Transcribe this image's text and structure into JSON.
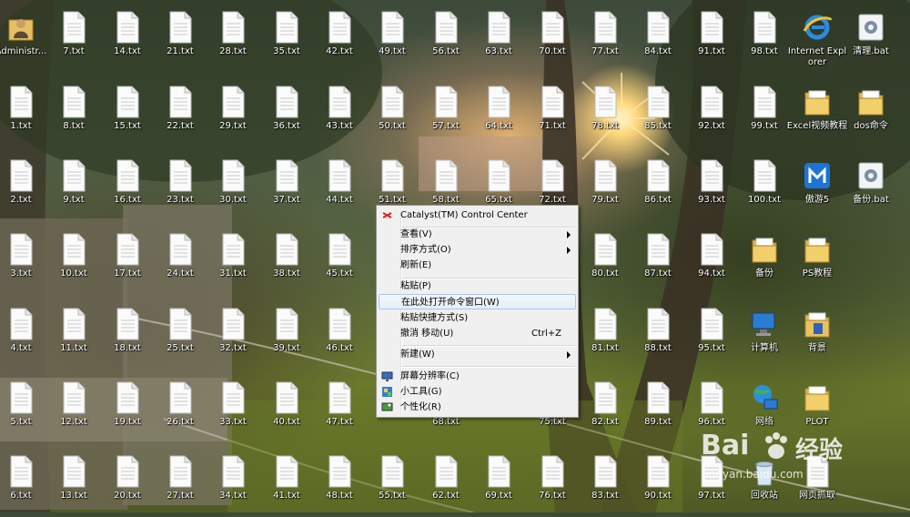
{
  "desktop": {
    "icons": [
      {
        "label": "Administr...",
        "type": "user-folder"
      },
      {
        "label": "7.txt",
        "type": "txt"
      },
      {
        "label": "14.txt",
        "type": "txt"
      },
      {
        "label": "21.txt",
        "type": "txt"
      },
      {
        "label": "28.txt",
        "type": "txt"
      },
      {
        "label": "35.txt",
        "type": "txt"
      },
      {
        "label": "42.txt",
        "type": "txt"
      },
      {
        "label": "49.txt",
        "type": "txt"
      },
      {
        "label": "56.txt",
        "type": "txt"
      },
      {
        "label": "63.txt",
        "type": "txt"
      },
      {
        "label": "70.txt",
        "type": "txt"
      },
      {
        "label": "77.txt",
        "type": "txt"
      },
      {
        "label": "84.txt",
        "type": "txt"
      },
      {
        "label": "91.txt",
        "type": "txt"
      },
      {
        "label": "98.txt",
        "type": "txt"
      },
      {
        "label": "Internet Explorer",
        "type": "ie"
      },
      {
        "label": "清理.bat",
        "type": "bat"
      },
      {
        "label": "1.txt",
        "type": "txt"
      },
      {
        "label": "8.txt",
        "type": "txt"
      },
      {
        "label": "15.txt",
        "type": "txt"
      },
      {
        "label": "22.txt",
        "type": "txt"
      },
      {
        "label": "29.txt",
        "type": "txt"
      },
      {
        "label": "36.txt",
        "type": "txt"
      },
      {
        "label": "43.txt",
        "type": "txt"
      },
      {
        "label": "50.txt",
        "type": "txt"
      },
      {
        "label": "57.txt",
        "type": "txt"
      },
      {
        "label": "64.txt",
        "type": "txt"
      },
      {
        "label": "71.txt",
        "type": "txt"
      },
      {
        "label": "78.txt",
        "type": "txt"
      },
      {
        "label": "85.txt",
        "type": "txt"
      },
      {
        "label": "92.txt",
        "type": "txt"
      },
      {
        "label": "99.txt",
        "type": "txt"
      },
      {
        "label": "Excel视频教程",
        "type": "folder"
      },
      {
        "label": "dos命令",
        "type": "folder"
      },
      {
        "label": "2.txt",
        "type": "txt"
      },
      {
        "label": "9.txt",
        "type": "txt"
      },
      {
        "label": "16.txt",
        "type": "txt"
      },
      {
        "label": "23.txt",
        "type": "txt"
      },
      {
        "label": "30.txt",
        "type": "txt"
      },
      {
        "label": "37.txt",
        "type": "txt"
      },
      {
        "label": "44.txt",
        "type": "txt"
      },
      {
        "label": "51.txt",
        "type": "txt"
      },
      {
        "label": "58.txt",
        "type": "txt"
      },
      {
        "label": "65.txt",
        "type": "txt"
      },
      {
        "label": "72.txt",
        "type": "txt"
      },
      {
        "label": "79.txt",
        "type": "txt"
      },
      {
        "label": "86.txt",
        "type": "txt"
      },
      {
        "label": "93.txt",
        "type": "txt"
      },
      {
        "label": "100.txt",
        "type": "txt"
      },
      {
        "label": "傲游5",
        "type": "maxthon"
      },
      {
        "label": "备份.bat",
        "type": "bat"
      },
      {
        "label": "3.txt",
        "type": "txt"
      },
      {
        "label": "10.txt",
        "type": "txt"
      },
      {
        "label": "17.txt",
        "type": "txt"
      },
      {
        "label": "24.txt",
        "type": "txt"
      },
      {
        "label": "31.txt",
        "type": "txt"
      },
      {
        "label": "38.txt",
        "type": "txt"
      },
      {
        "label": "45.txt",
        "type": "txt"
      },
      {
        "label": "80.txt",
        "type": "txt"
      },
      {
        "label": "87.txt",
        "type": "txt"
      },
      {
        "label": "94.txt",
        "type": "txt"
      },
      {
        "label": "备份",
        "type": "folder"
      },
      {
        "label": "PS教程",
        "type": "folder"
      },
      {
        "label": "4.txt",
        "type": "txt"
      },
      {
        "label": "11.txt",
        "type": "txt"
      },
      {
        "label": "18.txt",
        "type": "txt"
      },
      {
        "label": "25.txt",
        "type": "txt"
      },
      {
        "label": "32.txt",
        "type": "txt"
      },
      {
        "label": "39.txt",
        "type": "txt"
      },
      {
        "label": "46.txt",
        "type": "txt"
      },
      {
        "label": "81.txt",
        "type": "txt"
      },
      {
        "label": "88.txt",
        "type": "txt"
      },
      {
        "label": "95.txt",
        "type": "txt"
      },
      {
        "label": "计算机",
        "type": "computer"
      },
      {
        "label": "背景",
        "type": "folder-blue"
      },
      {
        "label": "5.txt",
        "type": "txt"
      },
      {
        "label": "12.txt",
        "type": "txt"
      },
      {
        "label": "19.txt",
        "type": "txt"
      },
      {
        "label": "26.txt",
        "type": "txt"
      },
      {
        "label": "33.txt",
        "type": "txt"
      },
      {
        "label": "40.txt",
        "type": "txt"
      },
      {
        "label": "47.txt",
        "type": "txt"
      },
      {
        "label": "68.txt",
        "type": "txt"
      },
      {
        "label": "75.txt",
        "type": "txt"
      },
      {
        "label": "82.txt",
        "type": "txt"
      },
      {
        "label": "89.txt",
        "type": "txt"
      },
      {
        "label": "96.txt",
        "type": "txt"
      },
      {
        "label": "网络",
        "type": "network"
      },
      {
        "label": "PLOT",
        "type": "folder"
      },
      {
        "label": "6.txt",
        "type": "txt"
      },
      {
        "label": "13.txt",
        "type": "txt"
      },
      {
        "label": "20.txt",
        "type": "txt"
      },
      {
        "label": "27.txt",
        "type": "txt"
      },
      {
        "label": "34.txt",
        "type": "txt"
      },
      {
        "label": "41.txt",
        "type": "txt"
      },
      {
        "label": "48.txt",
        "type": "txt"
      },
      {
        "label": "55.txt",
        "type": "txt"
      },
      {
        "label": "62.txt",
        "type": "txt"
      },
      {
        "label": "69.txt",
        "type": "txt"
      },
      {
        "label": "76.txt",
        "type": "txt"
      },
      {
        "label": "83.txt",
        "type": "txt"
      },
      {
        "label": "90.txt",
        "type": "txt"
      },
      {
        "label": "97.txt",
        "type": "txt"
      },
      {
        "label": "回收站",
        "type": "recycle"
      },
      {
        "label": "网页抓取",
        "type": "txt"
      }
    ]
  },
  "context_menu": {
    "items": [
      {
        "label": "Catalyst(TM) Control Center",
        "icon": "catalyst-icon"
      },
      {
        "label": "查看(V)",
        "submenu": true
      },
      {
        "label": "排序方式(O)",
        "submenu": true
      },
      {
        "label": "刷新(E)"
      },
      {
        "label": "粘贴(P)"
      },
      {
        "label": "在此处打开命令窗口(W)",
        "highlighted": true
      },
      {
        "label": "粘贴快捷方式(S)"
      },
      {
        "label": "撤消 移动(U)",
        "shortcut": "Ctrl+Z"
      },
      {
        "label": "新建(W)",
        "submenu": true
      },
      {
        "label": "屏幕分辨率(C)",
        "icon": "display-icon"
      },
      {
        "label": "小工具(G)",
        "icon": "gadgets-icon"
      },
      {
        "label": "个性化(R)",
        "icon": "personalize-icon"
      }
    ]
  },
  "watermark": {
    "brand": "Bai",
    "brand2": "经验",
    "url": "jingyan.baidu.com"
  },
  "colors": {
    "menu_bg": "#f0f0f0",
    "highlight_border": "#a8c8ef",
    "label_text": "#ffffff"
  }
}
